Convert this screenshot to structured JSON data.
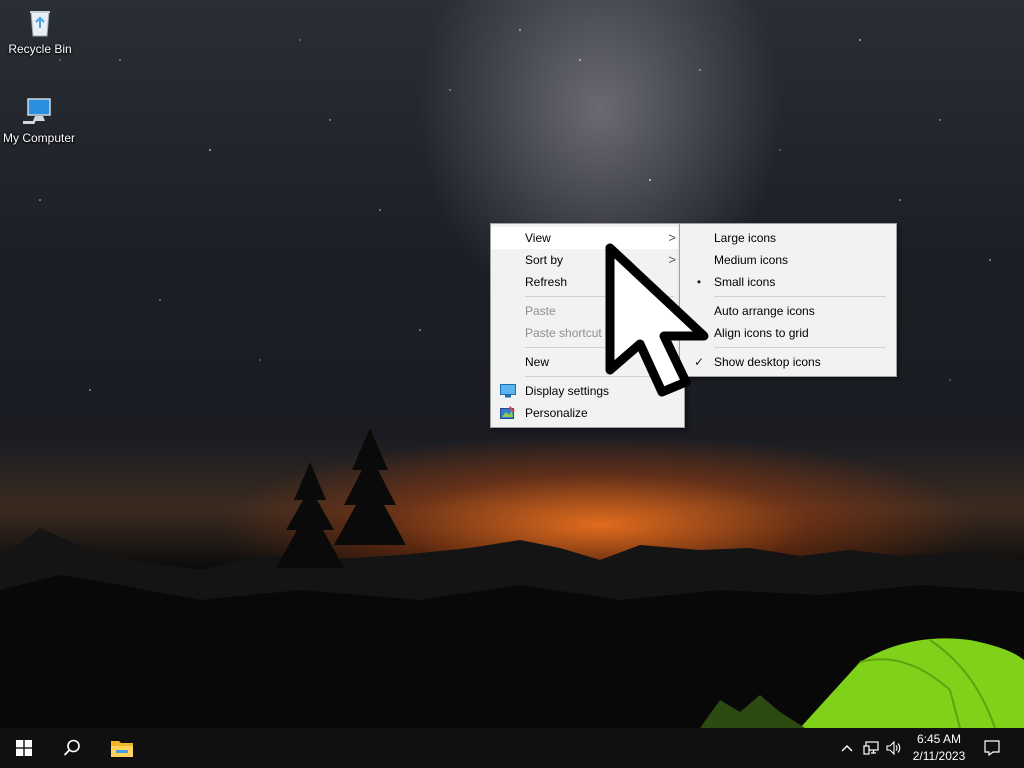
{
  "desktop": {
    "icons": [
      {
        "label": "Recycle Bin",
        "icon": "recycle-bin-icon"
      },
      {
        "label": "My Computer",
        "icon": "computer-icon"
      }
    ]
  },
  "context_menu": {
    "items": [
      {
        "label": "View",
        "has_submenu": true,
        "state": "highlighted"
      },
      {
        "label": "Sort by",
        "has_submenu": true
      },
      {
        "label": "Refresh"
      },
      {
        "label": "Paste",
        "state": "disabled"
      },
      {
        "label": "Paste shortcut",
        "state": "disabled"
      },
      {
        "label": "New",
        "has_submenu": true
      },
      {
        "label": "Display settings",
        "icon": "display-settings-icon"
      },
      {
        "label": "Personalize",
        "icon": "personalize-icon"
      }
    ]
  },
  "view_submenu": {
    "items": [
      {
        "label": "Large icons",
        "mark": ""
      },
      {
        "label": "Medium icons",
        "mark": ""
      },
      {
        "label": "Small icons",
        "mark": "•"
      },
      {
        "label": "Auto arrange icons",
        "mark": ""
      },
      {
        "label": "Align icons to grid",
        "mark": "✓"
      },
      {
        "label": "Show desktop icons",
        "mark": "✓"
      }
    ]
  },
  "taskbar": {
    "start": "windows-start-icon",
    "search": "search-icon",
    "pinned": [
      "file-explorer-icon"
    ],
    "tray": {
      "icons": [
        "chevron-up-icon",
        "network-icon",
        "volume-icon"
      ],
      "time": "6:45 AM",
      "date": "2/11/2023",
      "notifications": "action-center-icon"
    }
  },
  "colors": {
    "menu_bg": "#f2f2f2",
    "menu_highlight": "#ffffff",
    "taskbar_bg": "#101010",
    "tent_green": "#7fd11a"
  }
}
